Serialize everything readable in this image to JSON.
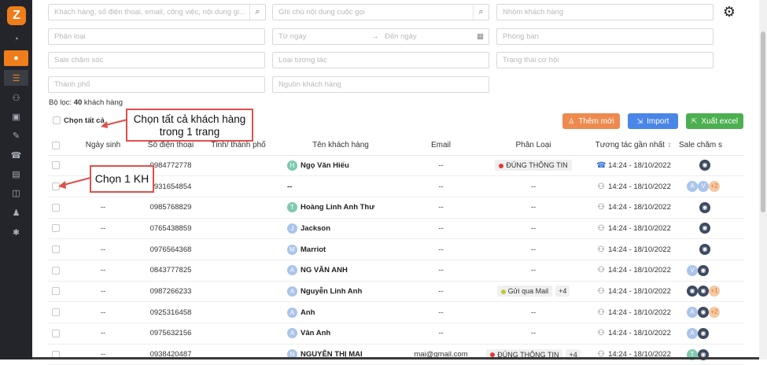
{
  "sidebar": {
    "logo": "Z",
    "icons": [
      "dashboard-icon",
      "user-icon",
      "list-icon",
      "users-icon",
      "briefcase-icon",
      "edit-icon",
      "phone-icon",
      "chart-icon",
      "box-icon",
      "user-tie-icon",
      "cog-icon"
    ]
  },
  "filters": {
    "search_placeholder": "Khách hàng, số điện thoại, email, công việc, nội dung gi...",
    "note_placeholder": "Ghi chú nội dung cuộc gọi",
    "group_placeholder": "Nhóm khách hàng",
    "category_placeholder": "Phân loại",
    "from_date": "Từ ngày",
    "to_date": "Đến ngày",
    "department_placeholder": "Phòng ban",
    "sale_placeholder": "Sale chăm sóc",
    "interaction_placeholder": "Loại tương tác",
    "opportunity_placeholder": "Trạng thái cơ hội",
    "city_placeholder": "Thành phố",
    "source_placeholder": "Nguồn khách hàng"
  },
  "filter_result": {
    "prefix": "Bộ lọc:",
    "count": "40",
    "suffix": "khách hàng"
  },
  "select_all_label": "Chọn tất cả",
  "buttons": {
    "add": "Thêm mới",
    "import": "Import",
    "export": "Xuất excel"
  },
  "colors": {
    "add": "#ee8a4f",
    "import": "#4a86e8",
    "export": "#4caf50",
    "accent": "#ef7d1a",
    "annotation_border": "#e0504b"
  },
  "annotations": {
    "select_page": "Chọn tất cả khách hàng trong 1 trang",
    "select_one": "Chọn 1 KH"
  },
  "table": {
    "headers": [
      "Ngày sinh",
      "Số điện thoại",
      "Tỉnh/ thành phố",
      "Tên khách hàng",
      "Email",
      "Phân Loại",
      "Tương tác gần nhất",
      "Sale chăm s"
    ],
    "rows": [
      {
        "dob": "--",
        "phone": "0984772778",
        "city": "",
        "initial": "H",
        "avatar_color": "#7fc9b0",
        "name": "Ngọ Văn Hiếu",
        "email": "--",
        "tag": "ĐÚNG THÔNG TIN",
        "tag_dot": "#e53935",
        "plus": "",
        "interaction_icon": "phone",
        "interaction": "14:24 - 18/10/2022",
        "sales": [
          "pic"
        ]
      },
      {
        "dob": "--",
        "phone": "0931654854",
        "city": "",
        "initial": "",
        "avatar_color": "",
        "name": "--",
        "email": "--",
        "tag": "",
        "tag_dot": "",
        "plus": "",
        "interaction_icon": "person",
        "interaction": "14:24 - 18/10/2022",
        "sales": [
          "l:A",
          "l:V",
          "o:+2"
        ]
      },
      {
        "dob": "--",
        "phone": "0985768829",
        "city": "",
        "initial": "T",
        "avatar_color": "#7fc9b0",
        "name": "Hoàng Linh Anh Thư",
        "email": "--",
        "tag": "",
        "tag_dot": "",
        "plus": "",
        "interaction_icon": "person",
        "interaction": "14:24 - 18/10/2022",
        "sales": [
          "pic"
        ]
      },
      {
        "dob": "--",
        "phone": "0765438859",
        "city": "",
        "initial": "J",
        "avatar_color": "#aac4ea",
        "name": "Jackson",
        "email": "--",
        "tag": "",
        "tag_dot": "",
        "plus": "",
        "interaction_icon": "person",
        "interaction": "14:24 - 18/10/2022",
        "sales": [
          "pic"
        ]
      },
      {
        "dob": "--",
        "phone": "0976564368",
        "city": "",
        "initial": "M",
        "avatar_color": "#aac4ea",
        "name": "Marriot",
        "email": "--",
        "tag": "",
        "tag_dot": "",
        "plus": "",
        "interaction_icon": "person",
        "interaction": "14:24 - 18/10/2022",
        "sales": [
          "pic"
        ]
      },
      {
        "dob": "--",
        "phone": "0843777825",
        "city": "",
        "initial": "A",
        "avatar_color": "#aac4ea",
        "name": "NG VĂN ANH",
        "email": "--",
        "tag": "",
        "tag_dot": "",
        "plus": "",
        "interaction_icon": "person",
        "interaction": "14:24 - 18/10/2022",
        "sales": [
          "l:V",
          "pic"
        ]
      },
      {
        "dob": "--",
        "phone": "0987266233",
        "city": "",
        "initial": "A",
        "avatar_color": "#aac4ea",
        "name": "Nguyễn Linh Anh",
        "email": "--",
        "tag": "Gửi qua Mail",
        "tag_dot": "#c0ca33",
        "plus": "+4",
        "interaction_icon": "person",
        "interaction": "14:24 - 18/10/2022",
        "sales": [
          "pic",
          "pic",
          "o:+1"
        ]
      },
      {
        "dob": "--",
        "phone": "0925316458",
        "city": "",
        "initial": "A",
        "avatar_color": "#aac4ea",
        "name": "Anh",
        "email": "--",
        "tag": "",
        "tag_dot": "",
        "plus": "",
        "interaction_icon": "person",
        "interaction": "14:24 - 18/10/2022",
        "sales": [
          "l:A",
          "pic",
          "o:+2"
        ]
      },
      {
        "dob": "--",
        "phone": "0975632156",
        "city": "",
        "initial": "A",
        "avatar_color": "#aac4ea",
        "name": "Vân Anh",
        "email": "--",
        "tag": "",
        "tag_dot": "",
        "plus": "",
        "interaction_icon": "person",
        "interaction": "14:24 - 18/10/2022",
        "sales": [
          "l:A",
          "pic"
        ]
      },
      {
        "dob": "--",
        "phone": "0938420487",
        "city": "",
        "initial": "N",
        "avatar_color": "#aac4ea",
        "name": "NGUYỄN THỊ MAI",
        "email": "mai@gmail.com",
        "tag": "ĐÚNG THÔNG TIN",
        "tag_dot": "#e53935",
        "plus": "+4",
        "interaction_icon": "person",
        "interaction": "14:24 - 18/10/2022",
        "sales": [
          "g:T",
          "pic"
        ]
      }
    ]
  }
}
